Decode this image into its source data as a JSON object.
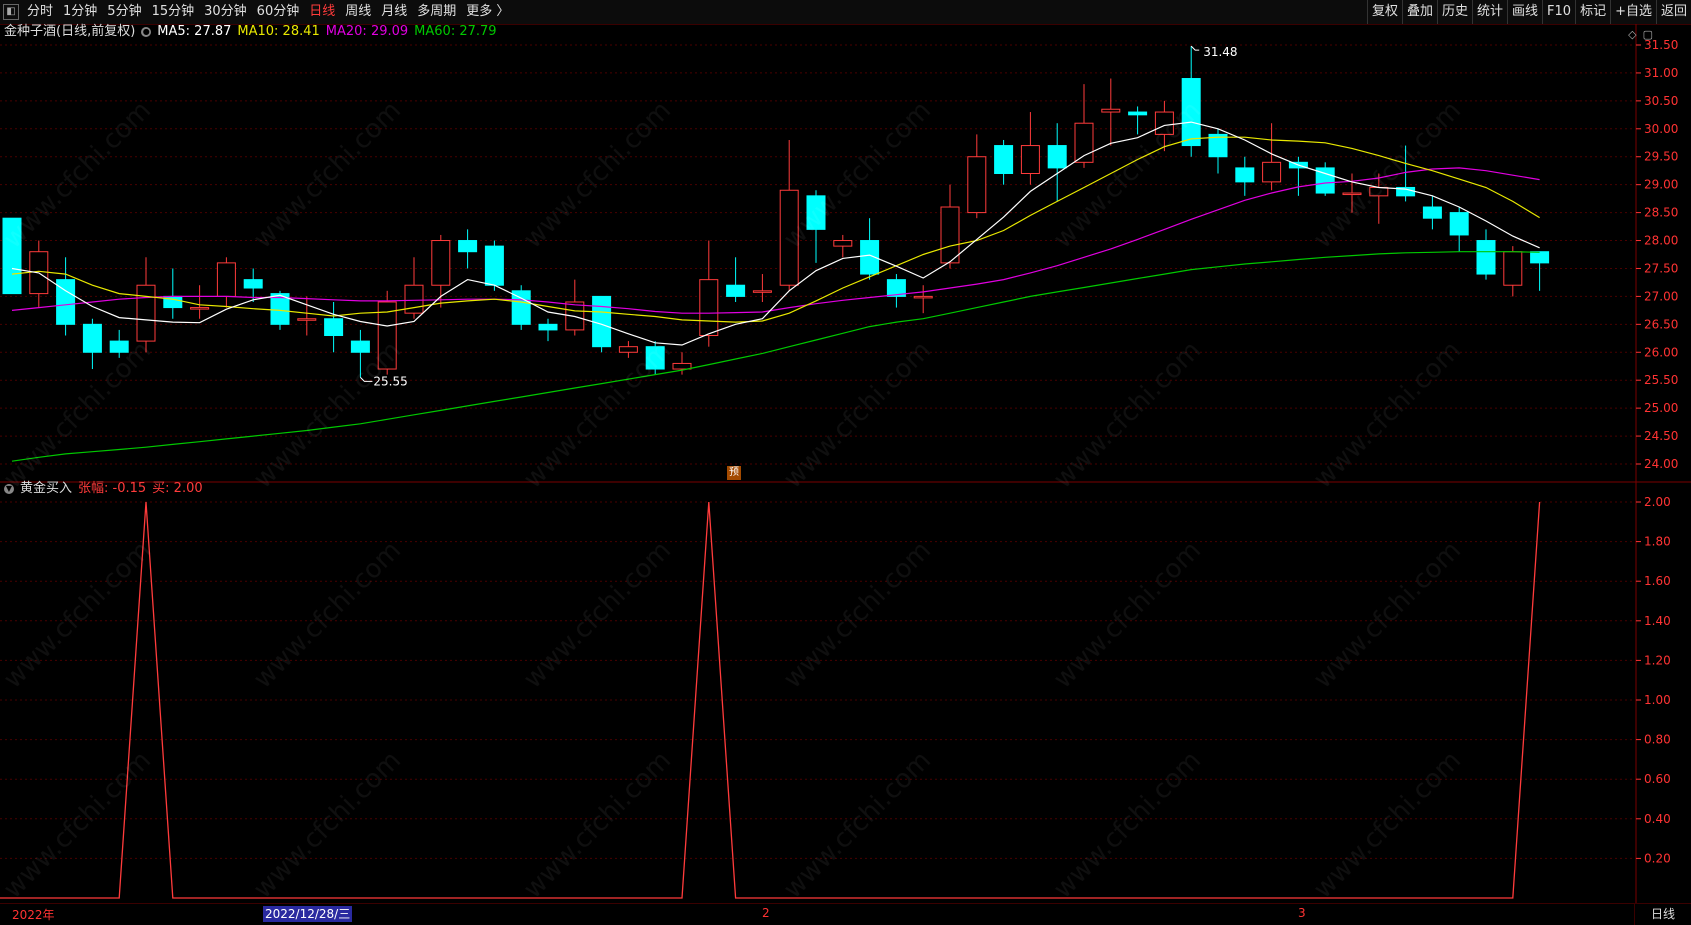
{
  "toolbar": {
    "left": [
      "分时",
      "1分钟",
      "5分钟",
      "15分钟",
      "30分钟",
      "60分钟",
      "日线",
      "周线",
      "月线",
      "多周期",
      "更多 〉"
    ],
    "active": "日线",
    "right": [
      "复权",
      "叠加",
      "历史",
      "统计",
      "画线",
      "F10",
      "标记",
      "+自选",
      "返回"
    ]
  },
  "main_info": {
    "name": "金种子酒(日线,前复权)",
    "ma5": "MA5: 27.87",
    "ma10": "MA10: 28.41",
    "ma20": "MA20: 29.09",
    "ma60": "MA60: 27.79"
  },
  "sub_info": {
    "name": "黄金买入",
    "change": "张幅: -0.15",
    "buy": "买: 2.00"
  },
  "pre_tag": "预",
  "bottom": {
    "year": "2022年",
    "cursor": "2022/12/28/三",
    "month2": "2",
    "month3": "3",
    "mode": "日线"
  },
  "watermark": "www.cfchi.com",
  "colors": {
    "up": "#ff3b3b",
    "down": "#00ffff",
    "ma5": "#ffffff",
    "ma10": "#e8e800",
    "ma20": "#e000e0",
    "ma60": "#00c800",
    "axis": "#ff3333",
    "grid": "#4a0000"
  },
  "chart_data": [
    {
      "type": "candlestick",
      "title": "金种子酒(日线,前复权)",
      "ylim": [
        24.0,
        31.5
      ],
      "y_ticks": [
        "31.50",
        "31.00",
        "30.50",
        "30.00",
        "29.50",
        "29.00",
        "28.50",
        "28.00",
        "27.50",
        "27.00",
        "26.50",
        "26.00",
        "25.50",
        "25.00",
        "24.50",
        "24.00"
      ],
      "annotations": [
        {
          "text": "31.48",
          "value": 31.48,
          "type": "high"
        },
        {
          "text": "25.55",
          "value": 25.55,
          "type": "low"
        }
      ],
      "candles": [
        [
          28.4,
          27.05,
          28.4,
          27.05
        ],
        [
          27.05,
          27.8,
          28.0,
          26.8
        ],
        [
          27.3,
          26.5,
          27.7,
          26.3
        ],
        [
          26.5,
          26.0,
          26.6,
          25.7
        ],
        [
          26.2,
          26.0,
          26.4,
          25.9
        ],
        [
          26.2,
          27.2,
          27.7,
          26.0
        ],
        [
          27.0,
          26.8,
          27.5,
          26.6
        ],
        [
          26.8,
          26.8,
          27.2,
          26.6
        ],
        [
          27.0,
          27.6,
          27.7,
          26.8
        ],
        [
          27.3,
          27.15,
          27.5,
          26.9
        ],
        [
          27.05,
          26.5,
          27.1,
          26.4
        ],
        [
          26.6,
          26.6,
          27.0,
          26.3
        ],
        [
          26.6,
          26.3,
          26.9,
          26.0
        ],
        [
          26.2,
          26.0,
          26.4,
          25.55
        ],
        [
          25.7,
          26.9,
          27.1,
          25.6
        ],
        [
          26.7,
          27.2,
          27.7,
          26.6
        ],
        [
          27.2,
          28.0,
          28.1,
          26.8
        ],
        [
          28.0,
          27.8,
          28.2,
          27.5
        ],
        [
          27.9,
          27.2,
          28.0,
          27.1
        ],
        [
          27.1,
          26.5,
          27.2,
          26.4
        ],
        [
          26.5,
          26.4,
          26.6,
          26.2
        ],
        [
          26.4,
          26.9,
          27.3,
          26.3
        ],
        [
          27.0,
          26.1,
          27.0,
          26.0
        ],
        [
          26.0,
          26.1,
          26.2,
          25.9
        ],
        [
          26.1,
          25.7,
          26.2,
          25.6
        ],
        [
          25.7,
          25.8,
          26.0,
          25.6
        ],
        [
          26.3,
          27.3,
          28.0,
          26.1
        ],
        [
          27.2,
          27.0,
          27.7,
          26.9
        ],
        [
          27.1,
          27.1,
          27.4,
          26.9
        ],
        [
          27.2,
          28.9,
          29.8,
          27.1
        ],
        [
          28.8,
          28.2,
          28.9,
          27.6
        ],
        [
          27.9,
          28.0,
          28.1,
          27.7
        ],
        [
          28.0,
          27.4,
          28.4,
          27.3
        ],
        [
          27.3,
          27.0,
          27.4,
          26.8
        ],
        [
          27.0,
          27.0,
          27.2,
          26.7
        ],
        [
          27.6,
          28.6,
          29.0,
          27.5
        ],
        [
          28.5,
          29.5,
          29.9,
          28.4
        ],
        [
          29.7,
          29.2,
          29.8,
          29.0
        ],
        [
          29.2,
          29.7,
          30.3,
          29.0
        ],
        [
          29.7,
          29.3,
          30.1,
          28.7
        ],
        [
          29.4,
          30.1,
          30.8,
          29.3
        ],
        [
          30.3,
          30.35,
          30.9,
          29.7
        ],
        [
          30.3,
          30.25,
          30.4,
          29.9
        ],
        [
          29.9,
          30.3,
          30.5,
          29.6
        ],
        [
          30.9,
          29.7,
          31.48,
          29.5
        ],
        [
          29.9,
          29.5,
          30.0,
          29.2
        ],
        [
          29.3,
          29.05,
          29.5,
          28.8
        ],
        [
          29.05,
          29.4,
          30.1,
          28.9
        ],
        [
          29.4,
          29.3,
          29.5,
          28.8
        ],
        [
          29.3,
          28.85,
          29.4,
          28.8
        ],
        [
          28.85,
          28.85,
          29.2,
          28.5
        ],
        [
          28.8,
          28.95,
          29.2,
          28.3
        ],
        [
          28.95,
          28.8,
          29.7,
          28.7
        ],
        [
          28.6,
          28.4,
          28.8,
          28.2
        ],
        [
          28.5,
          28.1,
          28.6,
          27.8
        ],
        [
          28.0,
          27.4,
          28.2,
          27.3
        ],
        [
          27.2,
          27.8,
          27.9,
          27.0
        ],
        [
          27.8,
          27.6,
          27.8,
          27.1
        ]
      ],
      "ma5": [
        27.5,
        27.42,
        27.1,
        26.82,
        26.62,
        26.58,
        26.54,
        26.53,
        26.77,
        26.94,
        27.02,
        26.85,
        26.68,
        26.55,
        26.47,
        26.55,
        27.0,
        27.3,
        27.2,
        26.97,
        26.72,
        26.64,
        26.5,
        26.33,
        26.17,
        26.13,
        26.33,
        26.5,
        26.6,
        27.1,
        27.46,
        27.68,
        27.74,
        27.54,
        27.33,
        27.62,
        28.02,
        28.42,
        28.88,
        29.2,
        29.52,
        29.74,
        29.84,
        30.06,
        30.12,
        30.0,
        29.8,
        29.55,
        29.35,
        29.2,
        29.05,
        28.95,
        28.92,
        28.8,
        28.6,
        28.35,
        28.08,
        27.87
      ],
      "ma10": [
        27.4,
        27.45,
        27.4,
        27.2,
        27.05,
        27.0,
        26.95,
        26.85,
        26.82,
        26.78,
        26.75,
        26.7,
        26.65,
        26.7,
        26.72,
        26.8,
        26.88,
        26.92,
        26.95,
        26.9,
        26.82,
        26.74,
        26.72,
        26.68,
        26.64,
        26.58,
        26.56,
        26.54,
        26.56,
        26.7,
        26.92,
        27.15,
        27.35,
        27.55,
        27.75,
        27.9,
        28.0,
        28.18,
        28.45,
        28.7,
        28.95,
        29.2,
        29.45,
        29.68,
        29.82,
        29.85,
        29.85,
        29.8,
        29.78,
        29.75,
        29.65,
        29.52,
        29.38,
        29.25,
        29.1,
        28.95,
        28.7,
        28.41
      ],
      "ma20": [
        26.75,
        26.8,
        26.85,
        26.9,
        26.95,
        26.98,
        27.0,
        27.0,
        27.0,
        26.98,
        26.98,
        26.96,
        26.94,
        26.92,
        26.92,
        26.93,
        26.94,
        26.95,
        26.95,
        26.94,
        26.9,
        26.85,
        26.82,
        26.78,
        26.73,
        26.7,
        26.7,
        26.71,
        26.72,
        26.8,
        26.87,
        26.93,
        26.98,
        27.03,
        27.08,
        27.15,
        27.22,
        27.3,
        27.42,
        27.55,
        27.7,
        27.85,
        28.02,
        28.2,
        28.38,
        28.55,
        28.72,
        28.85,
        28.96,
        29.03,
        29.06,
        29.12,
        29.22,
        29.28,
        29.3,
        29.25,
        29.17,
        29.09
      ],
      "ma60": [
        24.05,
        24.12,
        24.18,
        24.22,
        24.26,
        24.3,
        24.35,
        24.4,
        24.45,
        24.5,
        24.55,
        24.6,
        24.66,
        24.72,
        24.8,
        24.88,
        24.96,
        25.04,
        25.12,
        25.2,
        25.28,
        25.36,
        25.44,
        25.52,
        25.6,
        25.68,
        25.78,
        25.88,
        25.98,
        26.1,
        26.22,
        26.34,
        26.46,
        26.54,
        26.6,
        26.7,
        26.8,
        26.9,
        27.0,
        27.08,
        27.16,
        27.24,
        27.32,
        27.4,
        27.48,
        27.53,
        27.58,
        27.62,
        27.66,
        27.7,
        27.73,
        27.76,
        27.78,
        27.79,
        27.8,
        27.8,
        27.8,
        27.79
      ]
    },
    {
      "type": "line",
      "title": "黄金买入",
      "ylim": [
        0.0,
        2.0
      ],
      "y_ticks": [
        "2.00",
        "1.80",
        "1.60",
        "1.40",
        "1.20",
        "1.00",
        "0.80",
        "0.60",
        "0.40",
        "0.20"
      ],
      "x": [
        0,
        1,
        2,
        3,
        4,
        5,
        6,
        7,
        8,
        9,
        10,
        11,
        12,
        13,
        14,
        15,
        16,
        17,
        18,
        19,
        20,
        21,
        22,
        23,
        24,
        25,
        26,
        27,
        28,
        29,
        30,
        31,
        32,
        33,
        34,
        35,
        36,
        37,
        38,
        39,
        40,
        41,
        42,
        43,
        44,
        45,
        46,
        47,
        48,
        49,
        50,
        51,
        52,
        53,
        54,
        55,
        56,
        57
      ],
      "values": [
        0,
        0,
        0,
        0,
        0,
        2,
        0,
        0,
        0,
        0,
        0,
        0,
        0,
        0,
        0,
        0,
        0,
        0,
        0,
        0,
        0,
        0,
        0,
        0,
        0,
        0,
        2,
        0,
        0,
        0,
        0,
        0,
        0,
        0,
        0,
        0,
        0,
        0,
        0,
        0,
        0,
        0,
        0,
        0,
        0,
        0,
        0,
        0,
        0,
        0,
        0,
        0,
        0,
        0,
        0,
        0,
        0,
        2
      ]
    }
  ]
}
